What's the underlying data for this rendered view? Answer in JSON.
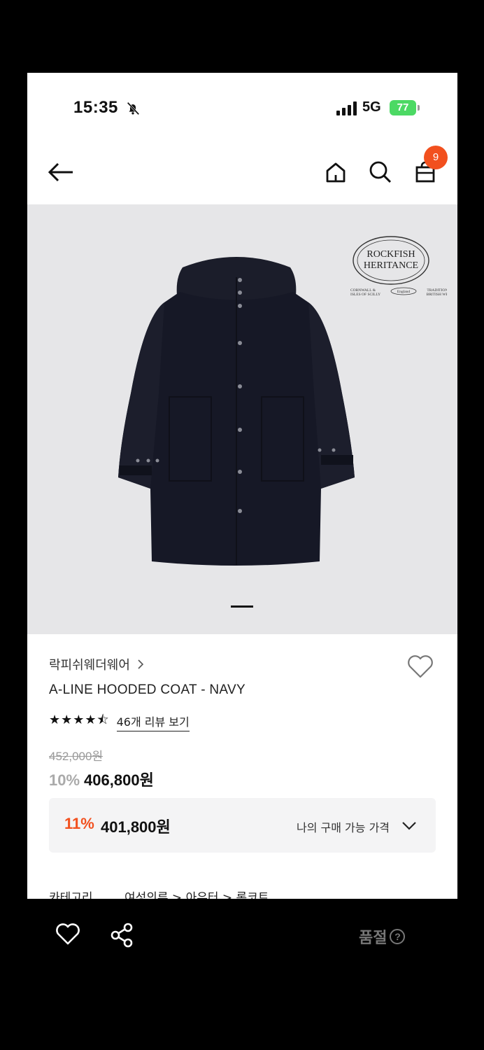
{
  "status_bar": {
    "time": "15:35",
    "network": "5G",
    "battery": "77"
  },
  "nav": {
    "cart_count": "9"
  },
  "gallery": {
    "logo_text": [
      "ROCKFISH",
      "HERITANCE",
      "CORNWALL &",
      "ISLES OF SCILLY",
      "England",
      "TRADITIONAL",
      "BRITISH WEAR"
    ]
  },
  "product": {
    "brand": "락피쉬웨더웨어",
    "title": "A-LINE HOODED COAT - NAVY",
    "stars": "★★★★⯪",
    "review_link": "46개 리뷰 보기",
    "original_price": "452,000원",
    "discount": "10%",
    "price": "406,800원"
  },
  "my_price": {
    "discount": "11%",
    "price": "401,800원",
    "label": "나의 구매 가능 가격"
  },
  "category": {
    "label": "카테고리",
    "path": "여성의류 > 아우터 > 롱코트"
  },
  "bottom_bar": {
    "soldout_label": "품절"
  },
  "colors": {
    "accent": "#f2501e",
    "badge": "#f2501e",
    "battery": "#4cd964"
  }
}
